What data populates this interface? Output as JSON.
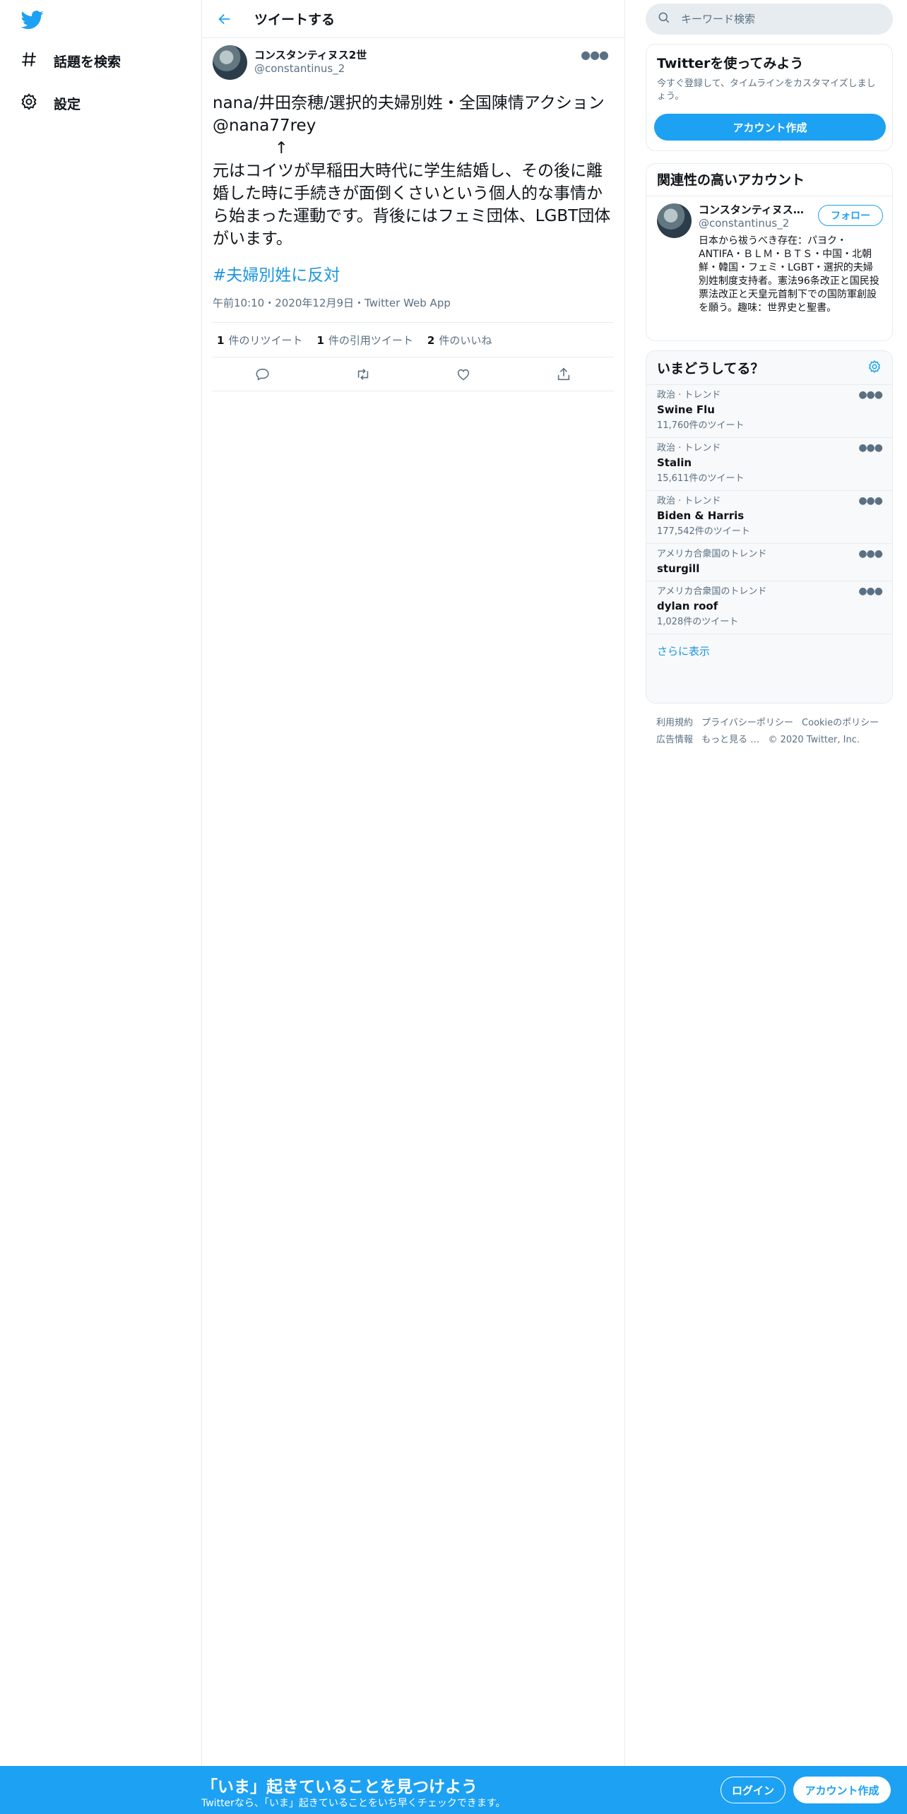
{
  "colors": {
    "accent": "#1da1f2",
    "link": "#1b95e0",
    "muted": "#5b7083",
    "text": "#0f1419"
  },
  "nav": {
    "logo_icon": "twitter-bird-icon",
    "items": [
      {
        "icon": "hashtag-icon",
        "label": "話題を検索"
      },
      {
        "icon": "gear-icon",
        "label": "設定"
      }
    ]
  },
  "header": {
    "title": "ツイートする",
    "back_icon": "back-arrow-icon"
  },
  "tweet": {
    "author_name": "コンスタンティヌス2世",
    "author_handle": "@constantinus_2",
    "more_icon": "more-dots-icon",
    "text": "nana/井田奈穂/選択的夫婦別姓・全国陳情アクション\n@nana77rey\n            ↑\n元はコイツが早稲田大時代に学生結婚し、その後に離婚した時に手続きが面倒くさいという個人的な事情から始まった運動です。背後にはフェミ団体、LGBT団体がいます。",
    "hashtag": "#夫婦別姓に反対",
    "time": "午前10:10・2020年12月9日・",
    "source": "Twitter Web App",
    "stats": {
      "retweets_count": "1",
      "retweets_label": "件のリツイート",
      "quotes_count": "1",
      "quotes_label": "件の引用ツイート",
      "likes_count": "2",
      "likes_label": "件のいいね"
    },
    "actions": [
      "reply-icon",
      "retweet-icon",
      "like-icon",
      "share-icon"
    ]
  },
  "search": {
    "placeholder": "キーワード検索",
    "icon": "search-icon"
  },
  "signup": {
    "title": "Twitterを使ってみよう",
    "desc": "今すぐ登録して、タイムラインをカスタマイズしましょう。",
    "button": "アカウント作成"
  },
  "related": {
    "title": "関連性の高いアカウント",
    "name": "コンスタンティヌス2...",
    "handle": "@constantinus_2",
    "follow": "フォロー",
    "bio": "日本から祓うべき存在：パヨク・ANTIFA・ＢＬＭ・ＢＴＳ・中国・北朝鮮・韓国・フェミ・LGBT・選択的夫婦別姓制度支持者。憲法96条改正と国民投票法改正と天皇元首制下での国防軍創設を願う。趣味：世界史と聖書。"
  },
  "trends": {
    "title": "いまどうしてる？",
    "settings_icon": "gear-icon",
    "items": [
      {
        "context": "政治 · トレンド",
        "name": "Swine Flu",
        "count": "11,760件のツイート"
      },
      {
        "context": "政治 · トレンド",
        "name": "Stalin",
        "count": "15,611件のツイート"
      },
      {
        "context": "政治 · トレンド",
        "name": "Biden & Harris",
        "count": "177,542件のツイート"
      },
      {
        "context": "アメリカ合衆国のトレンド",
        "name": "sturgill",
        "count": ""
      },
      {
        "context": "アメリカ合衆国のトレンド",
        "name": "dylan roof",
        "count": "1,028件のツイート"
      }
    ],
    "show_more": "さらに表示"
  },
  "footer": {
    "links": [
      "利用規約",
      "プライバシーポリシー",
      "Cookieのポリシー",
      "広告情報",
      "もっと見る …"
    ],
    "copyright": "© 2020 Twitter, Inc."
  },
  "bottom_bar": {
    "title": "「いま」起きていることを見つけよう",
    "subtitle": "Twitterなら、「いま」起きていることをいち早くチェックできます。",
    "login": "ログイン",
    "signup": "アカウント作成"
  }
}
